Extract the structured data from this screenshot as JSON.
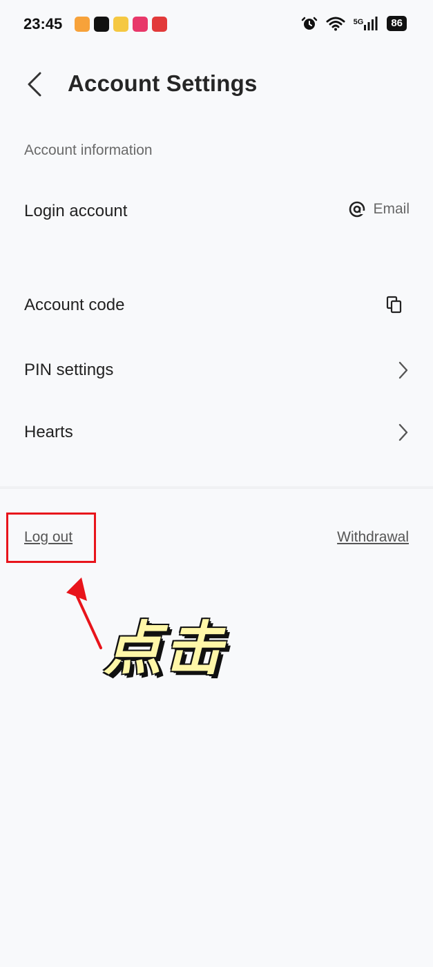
{
  "status_bar": {
    "time": "23:45",
    "network": "5G",
    "battery": "86"
  },
  "header": {
    "title": "Account Settings"
  },
  "account_info": {
    "section_label": "Account information",
    "rows": [
      {
        "label": "Login account",
        "value": "Email"
      },
      {
        "label": "Account code"
      },
      {
        "label": "PIN settings"
      },
      {
        "label": "Hearts"
      }
    ]
  },
  "footer": {
    "logout": "Log out",
    "withdrawal": "Withdrawal"
  },
  "annotation": {
    "text": "点击",
    "color": "#e8141b"
  }
}
